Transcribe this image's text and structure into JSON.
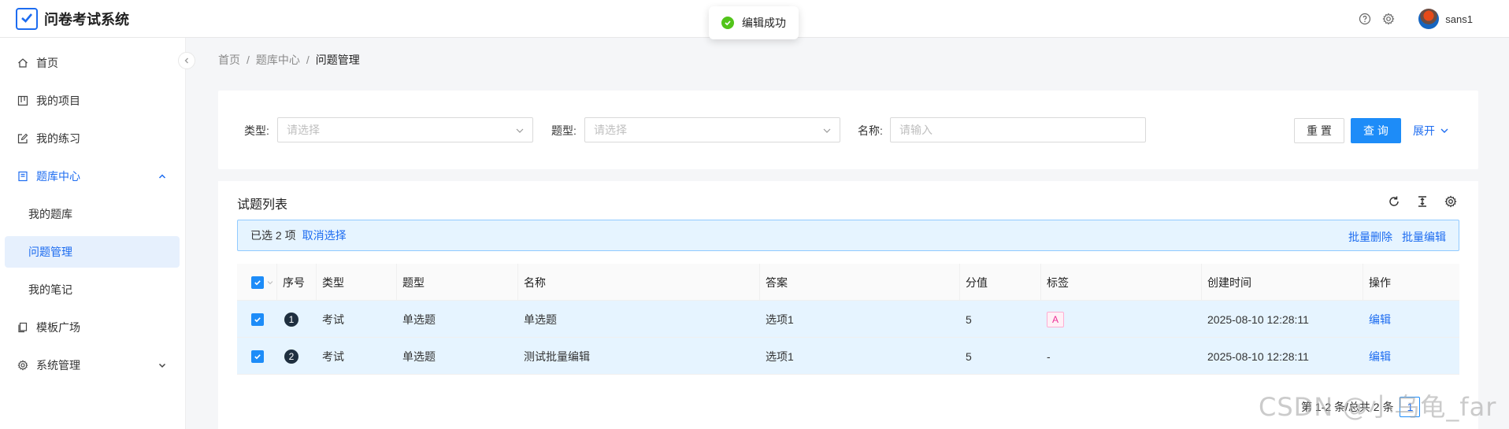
{
  "app": {
    "title": "问卷考试系统"
  },
  "toast": {
    "message": "编辑成功"
  },
  "header": {
    "username": "sans1",
    "icons": [
      "help-icon",
      "gear-icon"
    ]
  },
  "sidebar": {
    "items": [
      {
        "label": "首页",
        "icon": "home-icon"
      },
      {
        "label": "我的项目",
        "icon": "project-icon"
      },
      {
        "label": "我的练习",
        "icon": "edit-icon"
      },
      {
        "label": "题库中心",
        "icon": "book-icon",
        "expanded": true
      },
      {
        "label": "模板广场",
        "icon": "copy-icon"
      },
      {
        "label": "系统管理",
        "icon": "gear-icon",
        "expanded": false
      }
    ],
    "submenu": [
      {
        "label": "我的题库"
      },
      {
        "label": "问题管理",
        "selected": true
      },
      {
        "label": "我的笔记"
      }
    ]
  },
  "breadcrumb": [
    "首页",
    "题库中心",
    "问题管理"
  ],
  "breadcrumb_sep": "/",
  "search": {
    "type_label": "类型:",
    "type_placeholder": "请选择",
    "qtype_label": "题型:",
    "qtype_placeholder": "请选择",
    "name_label": "名称:",
    "name_placeholder": "请输入",
    "reset_label": "重 置",
    "query_label": "查 询",
    "expand_label": "展开"
  },
  "table": {
    "title": "试题列表",
    "selection": {
      "text": "已选 2 项",
      "cancel": "取消选择",
      "batch_delete": "批量删除",
      "batch_edit": "批量编辑"
    },
    "columns": [
      "序号",
      "类型",
      "题型",
      "名称",
      "答案",
      "分值",
      "标签",
      "创建时间",
      "操作"
    ],
    "rows": [
      {
        "index": "1",
        "type": "考试",
        "qtype": "单选题",
        "name": "单选题",
        "answer": "选项1",
        "score": "5",
        "tag": "A",
        "created": "2025-08-10 12:28:11",
        "action": "编辑"
      },
      {
        "index": "2",
        "type": "考试",
        "qtype": "单选题",
        "name": "测试批量编辑",
        "answer": "选项1",
        "score": "5",
        "tag": "-",
        "created": "2025-08-10 12:28:11",
        "action": "编辑"
      }
    ],
    "pagination": {
      "summary": "第 1-2 条/总共 2 条",
      "current_page": "1"
    }
  },
  "watermark": "CSDN @小乌龟_far",
  "colors": {
    "primary": "#1d8cf8",
    "link": "#1d6cf0",
    "selected_row": "#e6f4ff",
    "success": "#52c41a"
  }
}
